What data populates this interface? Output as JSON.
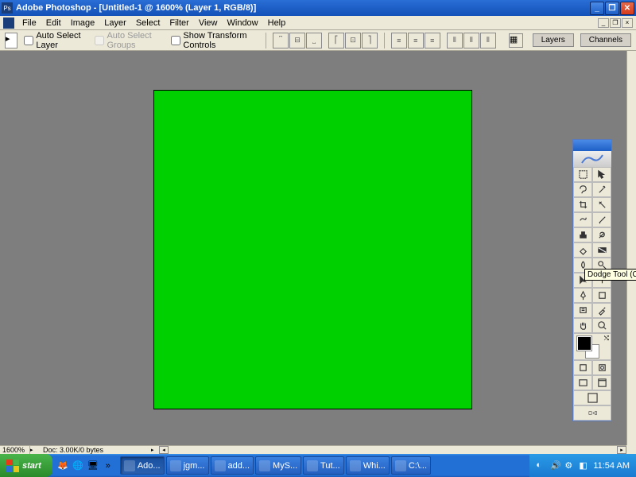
{
  "titlebar": {
    "title": "Adobe Photoshop - [Untitled-1 @ 1600% (Layer 1, RGB/8)]"
  },
  "menubar": {
    "items": [
      "File",
      "Edit",
      "Image",
      "Layer",
      "Select",
      "Filter",
      "View",
      "Window",
      "Help"
    ]
  },
  "optionsbar": {
    "auto_select_layer": "Auto Select Layer",
    "auto_select_groups": "Auto Select Groups",
    "show_transform": "Show Transform Controls"
  },
  "palettes": {
    "tabs": [
      "Layers",
      "Channels"
    ]
  },
  "canvas": {
    "color": "#00d000"
  },
  "status": {
    "zoom": "1600%",
    "docinfo": "Doc: 3.00K/0 bytes"
  },
  "tooltip": "Dodge Tool (O)",
  "taskbar": {
    "start": "start",
    "tasks": [
      "Ado...",
      "jgm...",
      "add...",
      "MyS...",
      "Tut...",
      "Whi...",
      "C:\\..."
    ],
    "active_task": 0,
    "clock": "11:54 AM"
  }
}
